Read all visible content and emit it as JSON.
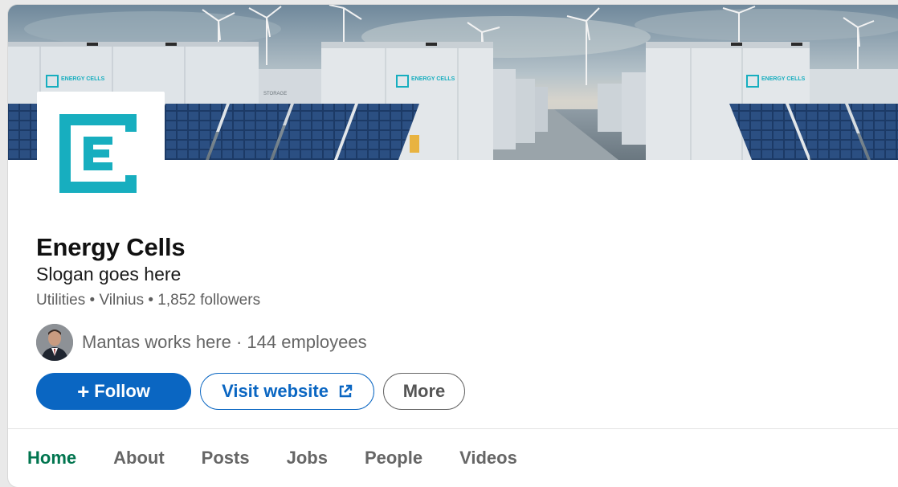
{
  "company": {
    "name": "Energy Cells",
    "slogan": "Slogan goes here",
    "meta": "Utilities • Vilnius • 1,852 followers",
    "employees_text": "Mantas works here · 144 employees"
  },
  "banner": {
    "container_label": "ENERGY CELLS",
    "storage_label": "STORAGE"
  },
  "actions": {
    "follow_plus": "+",
    "follow_label": "Follow",
    "visit_label": "Visit website",
    "more_label": "More"
  },
  "tabs": [
    {
      "label": "Home",
      "active": true
    },
    {
      "label": "About"
    },
    {
      "label": "Posts"
    },
    {
      "label": "Jobs"
    },
    {
      "label": "People"
    },
    {
      "label": "Videos"
    }
  ],
  "colors": {
    "brand_teal": "#17aebf",
    "follow_blue": "#0a66c2",
    "active_tab_green": "#01754f"
  },
  "icons": {
    "logo": "energy-cells-logo",
    "external_link": "external-link-icon",
    "avatar": "employee-avatar"
  }
}
